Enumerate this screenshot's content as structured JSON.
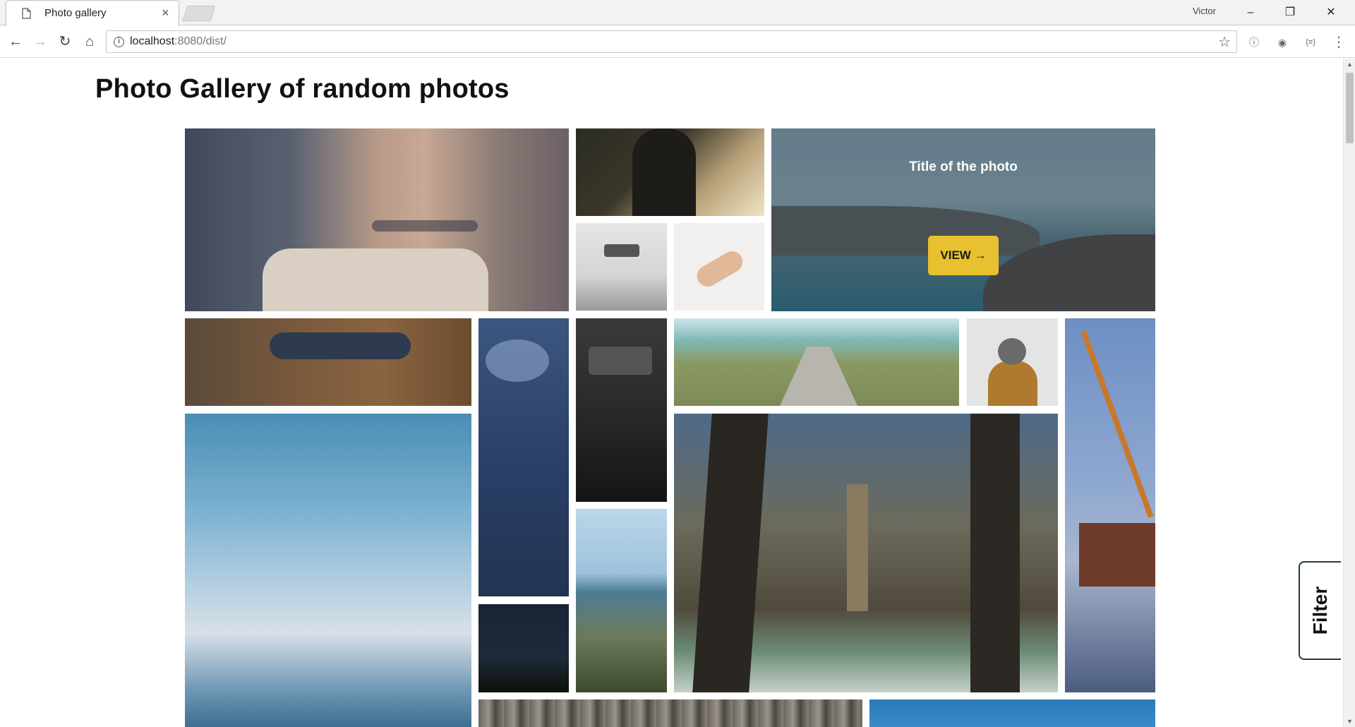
{
  "browser": {
    "tab_title": "Photo gallery",
    "tab_close": "×",
    "profile_name": "Victor",
    "window_buttons": {
      "minimize": "–",
      "restore": "❐",
      "close": "✕"
    },
    "nav": {
      "back": "←",
      "forward": "→",
      "reload": "↻",
      "home": "⌂"
    },
    "address_host": "localhost",
    "address_rest": ":8080/dist/",
    "info_glyph": "i",
    "star_glyph": "☆",
    "extensions": [
      "ⓘ",
      "◉",
      "{≡}"
    ],
    "menu_glyph": "⋮"
  },
  "page": {
    "title": "Photo Gallery of random photos",
    "hovered_photo": {
      "title": "Title of the photo",
      "button_label": "VIEW →"
    },
    "filter_label": "Filter"
  },
  "photos": [
    "portrait-woman-sweater",
    "man-sunset-car",
    "coastal-cliffs",
    "car-mirror",
    "holding-hands",
    "legs-boots-bench",
    "blue-water-fish",
    "car-dashboard",
    "beach-boardwalk",
    "hooded-person",
    "ship-crane-harbor",
    "sky-clouds-sea",
    "night-stars-trees",
    "coastal-town",
    "pier-waves",
    "pebbles",
    "blue-sky"
  ],
  "colors": {
    "accent_button": "#e7c12f",
    "filter_border": "#1f3a44"
  }
}
